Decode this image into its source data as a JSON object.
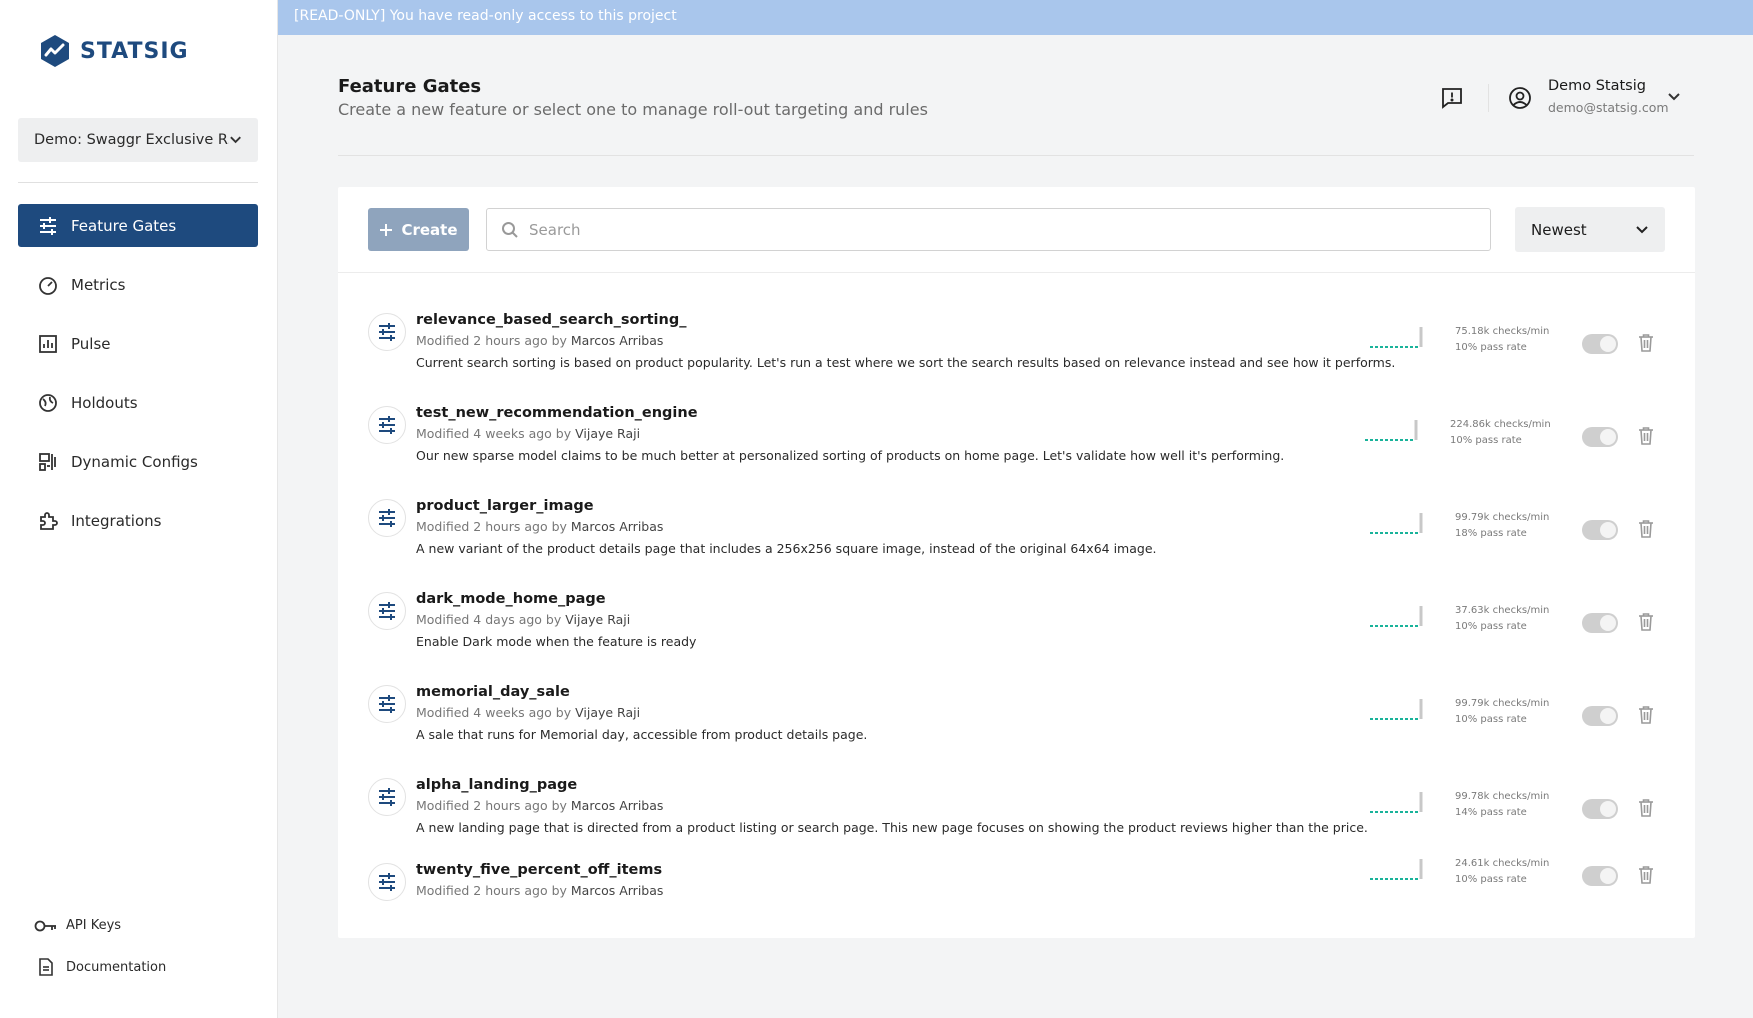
{
  "brand": {
    "name": "STATSIG",
    "color": "#1e4a7e"
  },
  "banner": {
    "text": "[READ-ONLY] You have read-only access to this project"
  },
  "project": {
    "selected": "Demo: Swaggr Exclusive R..."
  },
  "nav": [
    {
      "label": "Feature Gates",
      "icon": "sliders-icon",
      "active": true
    },
    {
      "label": "Metrics",
      "icon": "gauge-icon",
      "active": false
    },
    {
      "label": "Pulse",
      "icon": "bar-chart-icon",
      "active": false
    },
    {
      "label": "Holdouts",
      "icon": "blocked-globe-icon",
      "active": false
    },
    {
      "label": "Dynamic Configs",
      "icon": "config-icon",
      "active": false
    },
    {
      "label": "Integrations",
      "icon": "puzzle-icon",
      "active": false
    }
  ],
  "sidebar_bottom": {
    "api_keys": "API Keys",
    "documentation": "Documentation"
  },
  "header": {
    "title": "Feature Gates",
    "subtitle": "Create a new feature or select one to manage roll-out targeting and rules"
  },
  "user": {
    "name": "Demo Statsig",
    "email": "demo@statsig.com"
  },
  "toolbar": {
    "create_label": "Create",
    "search_placeholder": "Search",
    "sort_value": "Newest"
  },
  "gates": [
    {
      "name": "relevance_based_search_sorting_",
      "modified": "Modified 2 hours ago by ",
      "author": "Marcos Arribas",
      "description": "Current search sorting is based on product popularity. Let's run a test where we sort the search results based on relevance instead and see how it performs.",
      "checks": "75.18k checks/min",
      "pass_rate": "10% pass rate",
      "enabled": true
    },
    {
      "name": "test_new_recommendation_engine",
      "modified": "Modified 4 weeks ago by ",
      "author": "Vijaye Raji",
      "description": "Our new sparse model claims to be much better at personalized sorting of products on home page. Let's validate how well it's performing.",
      "checks": "224.86k checks/min",
      "pass_rate": "10% pass rate",
      "enabled": true
    },
    {
      "name": "product_larger_image",
      "modified": "Modified 2 hours ago by ",
      "author": "Marcos Arribas",
      "description": "A new variant of the product details page that includes a 256x256 square image, instead of the original 64x64 image.",
      "checks": "99.79k checks/min",
      "pass_rate": "18% pass rate",
      "enabled": true
    },
    {
      "name": "dark_mode_home_page",
      "modified": "Modified 4 days ago by ",
      "author": "Vijaye Raji",
      "description": "Enable Dark mode when the feature is ready",
      "checks": "37.63k checks/min",
      "pass_rate": "10% pass rate",
      "enabled": true
    },
    {
      "name": "memorial_day_sale",
      "modified": "Modified 4 weeks ago by ",
      "author": "Vijaye Raji",
      "description": "A sale that runs for Memorial day, accessible from product details page.",
      "checks": "99.79k checks/min",
      "pass_rate": "10% pass rate",
      "enabled": true
    },
    {
      "name": "alpha_landing_page",
      "modified": "Modified 2 hours ago by ",
      "author": "Marcos Arribas",
      "description": "A new landing page that is directed from a product listing or search page. This new page focuses on showing the product reviews higher than the price.",
      "checks": "99.78k checks/min",
      "pass_rate": "14% pass rate",
      "enabled": true
    },
    {
      "name": "twenty_five_percent_off_items",
      "modified": "Modified 2 hours ago by ",
      "author": "Marcos Arribas",
      "description": "",
      "checks": "24.61k checks/min",
      "pass_rate": "10% pass rate",
      "enabled": true
    }
  ],
  "colors": {
    "accent": "#1e4a7e",
    "banner": "#a9c6ec",
    "sparkline": "#19b39a"
  }
}
